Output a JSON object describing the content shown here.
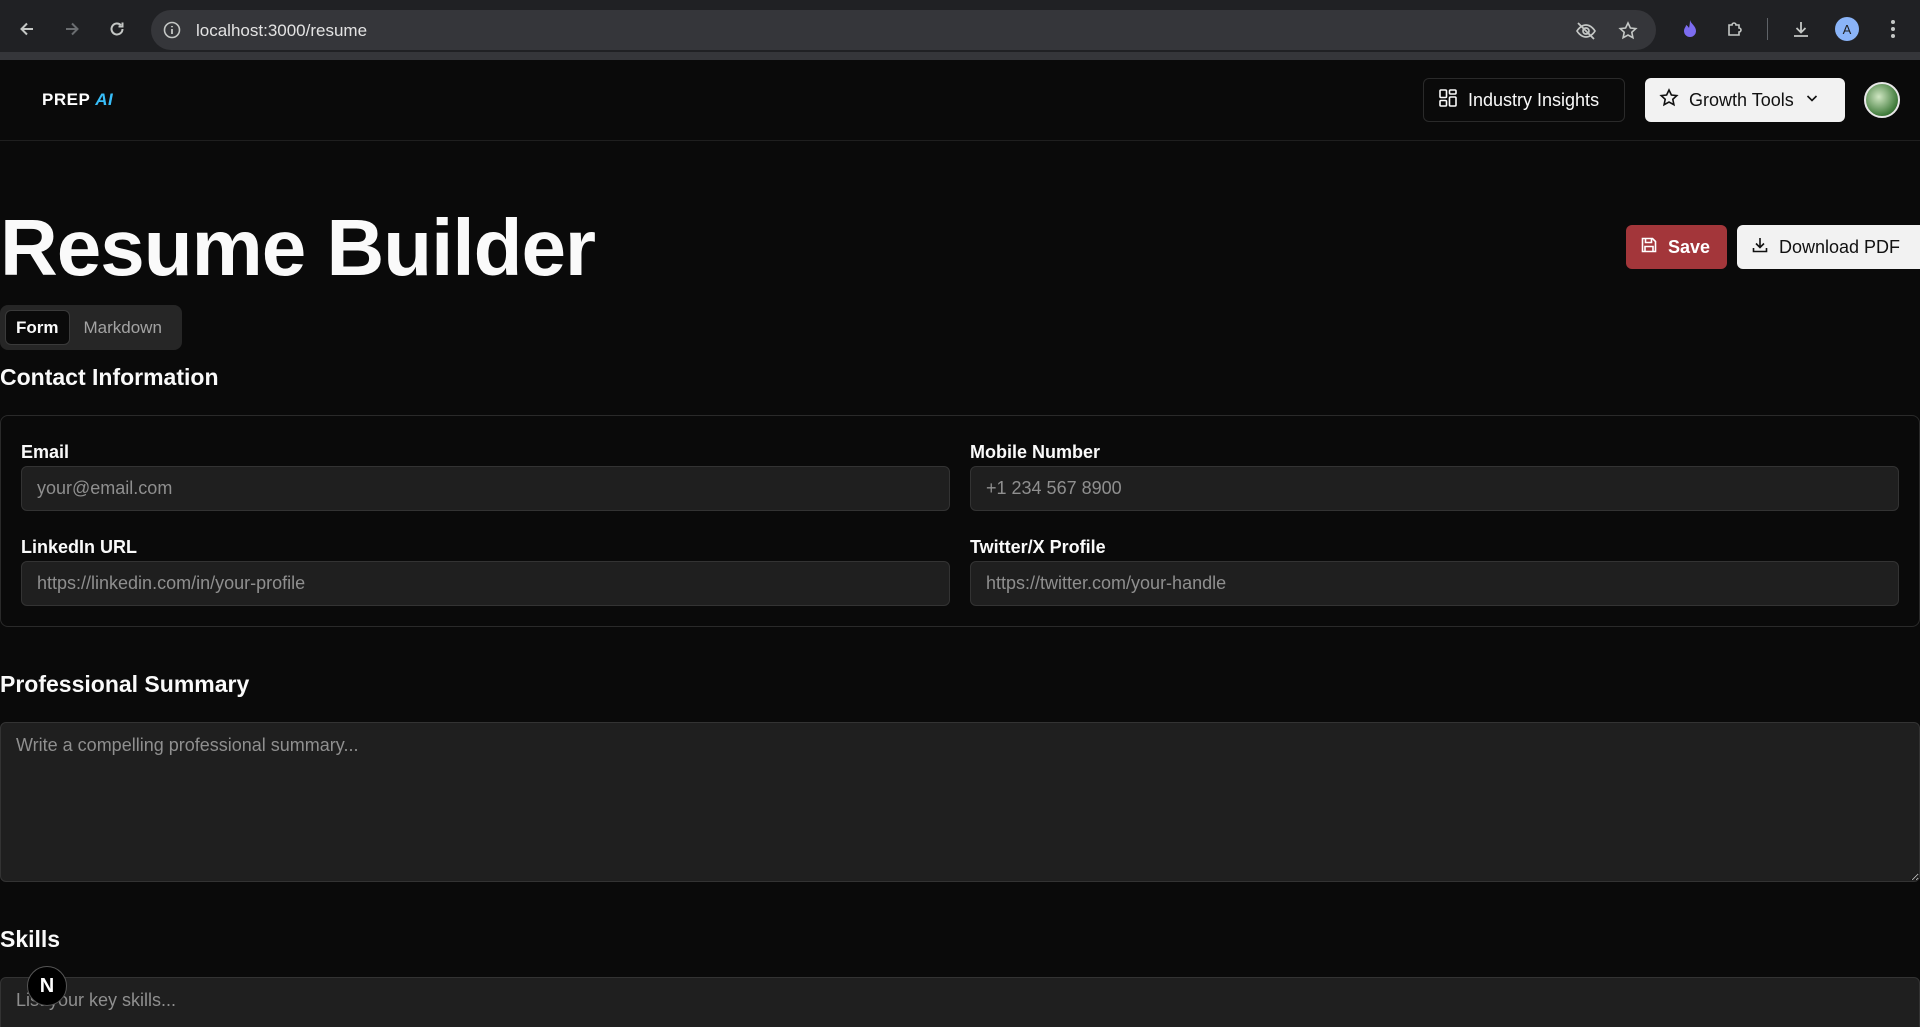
{
  "browser": {
    "url": "localhost:3000/resume",
    "profile_initial": "A"
  },
  "header": {
    "logo_prep": "PREP",
    "logo_ai": "AI",
    "industry_insights_label": "Industry Insights",
    "growth_tools_label": "Growth Tools"
  },
  "main": {
    "title": "Resume Builder",
    "save_label": "Save",
    "download_label": "Download PDF",
    "tabs": [
      {
        "label": "Form",
        "active": true
      },
      {
        "label": "Markdown",
        "active": false
      }
    ]
  },
  "contact": {
    "title": "Contact Information",
    "email_label": "Email",
    "email_placeholder": "your@email.com",
    "mobile_label": "Mobile Number",
    "mobile_placeholder": "+1 234 567 8900",
    "linkedin_label": "LinkedIn URL",
    "linkedin_placeholder": "https://linkedin.com/in/your-profile",
    "twitter_label": "Twitter/X Profile",
    "twitter_placeholder": "https://twitter.com/your-handle"
  },
  "summary": {
    "title": "Professional Summary",
    "placeholder": "Write a compelling professional summary..."
  },
  "skills": {
    "title": "Skills",
    "placeholder": "List your key skills..."
  },
  "dev_badge": "N"
}
